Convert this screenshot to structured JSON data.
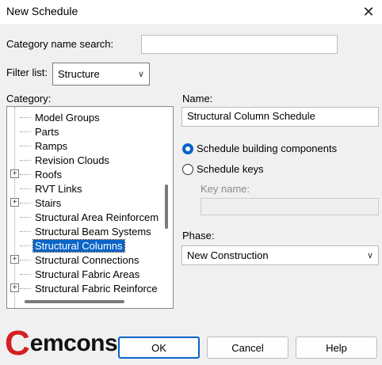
{
  "window": {
    "title": "New Schedule",
    "close_glyph": "✕"
  },
  "category_search": {
    "label": "Category name search:",
    "value": "",
    "placeholder": ""
  },
  "filter": {
    "label": "Filter list:",
    "value": "Structure"
  },
  "category": {
    "label": "Category:",
    "items": [
      {
        "label": "Model Groups",
        "expandable": false,
        "selected": false
      },
      {
        "label": "Parts",
        "expandable": false,
        "selected": false
      },
      {
        "label": "Ramps",
        "expandable": false,
        "selected": false
      },
      {
        "label": "Revision Clouds",
        "expandable": false,
        "selected": false
      },
      {
        "label": "Roofs",
        "expandable": true,
        "selected": false
      },
      {
        "label": "RVT Links",
        "expandable": false,
        "selected": false
      },
      {
        "label": "Stairs",
        "expandable": true,
        "selected": false
      },
      {
        "label": "Structural Area Reinforcem",
        "expandable": false,
        "selected": false
      },
      {
        "label": "Structural Beam Systems",
        "expandable": false,
        "selected": false
      },
      {
        "label": "Structural Columns",
        "expandable": false,
        "selected": true
      },
      {
        "label": "Structural Connections",
        "expandable": true,
        "selected": false
      },
      {
        "label": "Structural Fabric Areas",
        "expandable": false,
        "selected": false
      },
      {
        "label": "Structural Fabric Reinforce",
        "expandable": true,
        "selected": false
      }
    ]
  },
  "name": {
    "label": "Name:",
    "value": "Structural Column Schedule"
  },
  "schedule_type": {
    "building_components": "Schedule building components",
    "keys": "Schedule keys",
    "selected": "building_components"
  },
  "key_name": {
    "label": "Key name:",
    "value": ""
  },
  "phase": {
    "label": "Phase:",
    "value": "New Construction"
  },
  "buttons": {
    "ok": "OK",
    "cancel": "Cancel",
    "help": "Help"
  },
  "logo": {
    "first": "C",
    "rest": "emcons",
    "brand_color": "#d42020"
  },
  "colors": {
    "accent": "#0a64c8"
  }
}
